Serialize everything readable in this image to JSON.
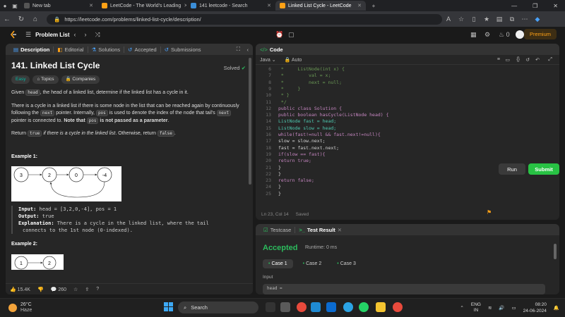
{
  "browser": {
    "tabs": [
      {
        "label": "New tab",
        "active": false
      },
      {
        "label": "LeetCode - The World's Leading",
        "active": false
      },
      {
        "label": "141 leetcode - Search",
        "active": false
      },
      {
        "label": "Linked List Cycle - LeetCode",
        "active": true
      }
    ],
    "url": "https://leetcode.com/problems/linked-list-cycle/description/"
  },
  "lc_bar": {
    "problem_list": "Problem List",
    "streak": "0",
    "premium": "Premium"
  },
  "left_panel": {
    "tabs": [
      "Description",
      "Editorial",
      "Solutions",
      "Accepted",
      "Submissions"
    ],
    "title": "141. Linked List Cycle",
    "solved": "Solved",
    "chips": [
      "Easy",
      "Topics",
      "Companies"
    ],
    "para1_pre": "Given ",
    "para1_code": "head",
    "para1_post": ", the head of a linked list, determine if the linked list has a cycle in it.",
    "para2_a": "There is a cycle in a linked list if there is some node in the list that can be reached again by continuously following the ",
    "para2_code1": "next",
    "para2_b": " pointer. Internally, ",
    "para2_code2": "pos",
    "para2_c": " is used to denote the index of the node that tail's ",
    "para2_code3": "next",
    "para2_d": " pointer is connected to. ",
    "para2_bold1": "Note that ",
    "para2_code4": "pos",
    "para2_bold2": " is not passed as a parameter",
    "para2_end": ".",
    "para3_pre": "Return ",
    "para3_code1": "true",
    "para3_mid": " if there is a cycle in the linked list",
    "para3_post": ". Otherwise, return ",
    "para3_code2": "false",
    "para3_end": ".",
    "example1": "Example 1:",
    "example1_nodes": [
      "3",
      "2",
      "0",
      "-4"
    ],
    "input_label": "Input:",
    "input_value": " head = [3,2,0,-4], pos = 1",
    "output_label": "Output:",
    "output_value": " true",
    "explanation_label": "Explanation:",
    "explanation_value": " There is a cycle in the linked list, where the tail",
    "explanation_value2": "connects to the 1st node (0-indexed).",
    "example2": "Example 2:",
    "example2_nodes": [
      "1",
      "2"
    ],
    "likes": "15.4K",
    "comments": "260"
  },
  "code_panel": {
    "title": "Code",
    "language": "Java",
    "mode": "Auto",
    "lines": [
      {
        "n": "6",
        "t": " *     ListNode(int x) {"
      },
      {
        "n": "7",
        "t": " *         val = x;"
      },
      {
        "n": "8",
        "t": " *         next = null;"
      },
      {
        "n": "9",
        "t": " *     }"
      },
      {
        "n": "10",
        "t": " * }"
      },
      {
        "n": "11",
        "t": " */"
      },
      {
        "n": "12",
        "t": "public class Solution {"
      },
      {
        "n": "13",
        "t": "public boolean hasCycle(ListNode head) {"
      },
      {
        "n": "14",
        "t": "ListNode fast = head;"
      },
      {
        "n": "15",
        "t": "ListNode slow = head;"
      },
      {
        "n": "16",
        "t": "while(fast!=null && fast.next!=null){"
      },
      {
        "n": "17",
        "t": "slow = slow.next;"
      },
      {
        "n": "18",
        "t": "fast = fast.next.next;"
      },
      {
        "n": "19",
        "t": "if(slow == fast){"
      },
      {
        "n": "20",
        "t": "return true;"
      },
      {
        "n": "21",
        "t": "}"
      },
      {
        "n": "22",
        "t": "}"
      },
      {
        "n": "23",
        "t": "return false;"
      },
      {
        "n": "24",
        "t": "}"
      },
      {
        "n": "25",
        "t": "}"
      }
    ],
    "cursor": "Ln 23, Col 14",
    "saved": "Saved",
    "run": "Run",
    "submit": "Submit"
  },
  "result_panel": {
    "tabs": [
      "Testcase",
      "Test Result"
    ],
    "status": "Accepted",
    "runtime": "Runtime: 0 ms",
    "cases": [
      "Case 1",
      "Case 2",
      "Case 3"
    ],
    "input_label": "Input",
    "input_value": "head ="
  },
  "taskbar": {
    "temp": "26°C",
    "weather": "Haze",
    "search": "Search",
    "lang1": "ENG",
    "lang2": "IN",
    "time": "08:20",
    "date": "24-06-2024"
  },
  "colors": {
    "accent": "#ffa116",
    "accepted": "#2cbb5d",
    "submit": "#28c244"
  }
}
